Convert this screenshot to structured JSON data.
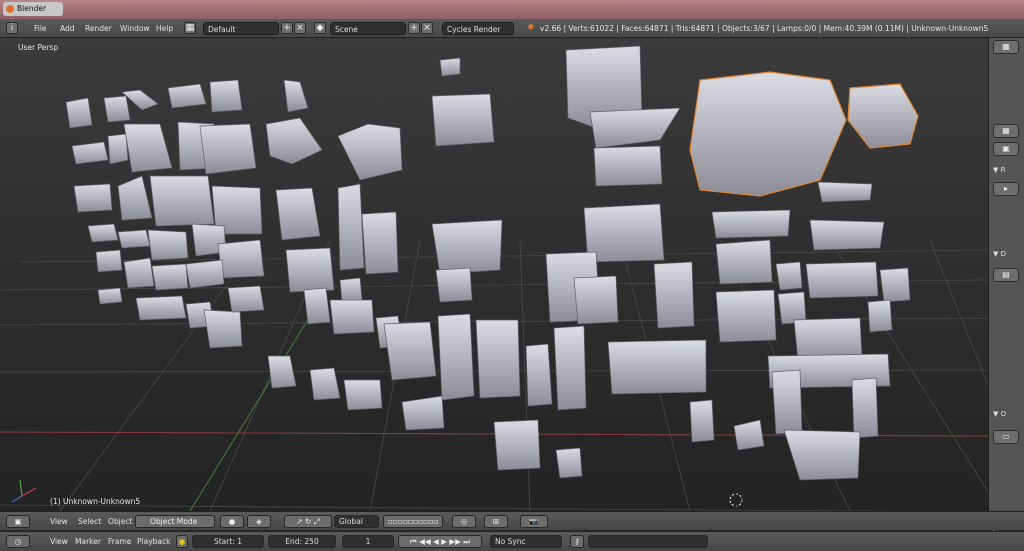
{
  "window": {
    "title": "Blender"
  },
  "info_header": {
    "menu": [
      "File",
      "Add",
      "Render",
      "Window",
      "Help"
    ],
    "layout_name": "Default",
    "scene_name": "Scene",
    "render_engine": "Cycles Render",
    "stats": "v2.66 | Verts:61022 | Faces:64871 | Tris:64871 | Objects:3/67 | Lamps:0/0 | Mem:40.39M (0.11M) | Unknown-Unknown5"
  },
  "viewport": {
    "view_label": "User Persp",
    "object_label": "(1) Unknown-Unknown5",
    "icons": [
      "axis-gizmo-icon",
      "3d-cursor-icon"
    ]
  },
  "view3d_header": {
    "menu": [
      "View",
      "Select",
      "Object"
    ],
    "mode": "Object Mode",
    "orientation": "Global"
  },
  "timeline_header": {
    "menu": [
      "View",
      "Marker",
      "Frame",
      "Playback"
    ],
    "start": "Start: 1",
    "end": "End: 250",
    "current_frame": "1",
    "sync": "No Sync"
  },
  "sidebar": {
    "panel_labels": [
      "R",
      "D",
      "O",
      "S"
    ]
  },
  "colors": {
    "selection_outline": "#e0832f",
    "grid": "#4a4a4a",
    "x_axis": "#8a3a3a",
    "y_axis": "#4f7a3a"
  }
}
